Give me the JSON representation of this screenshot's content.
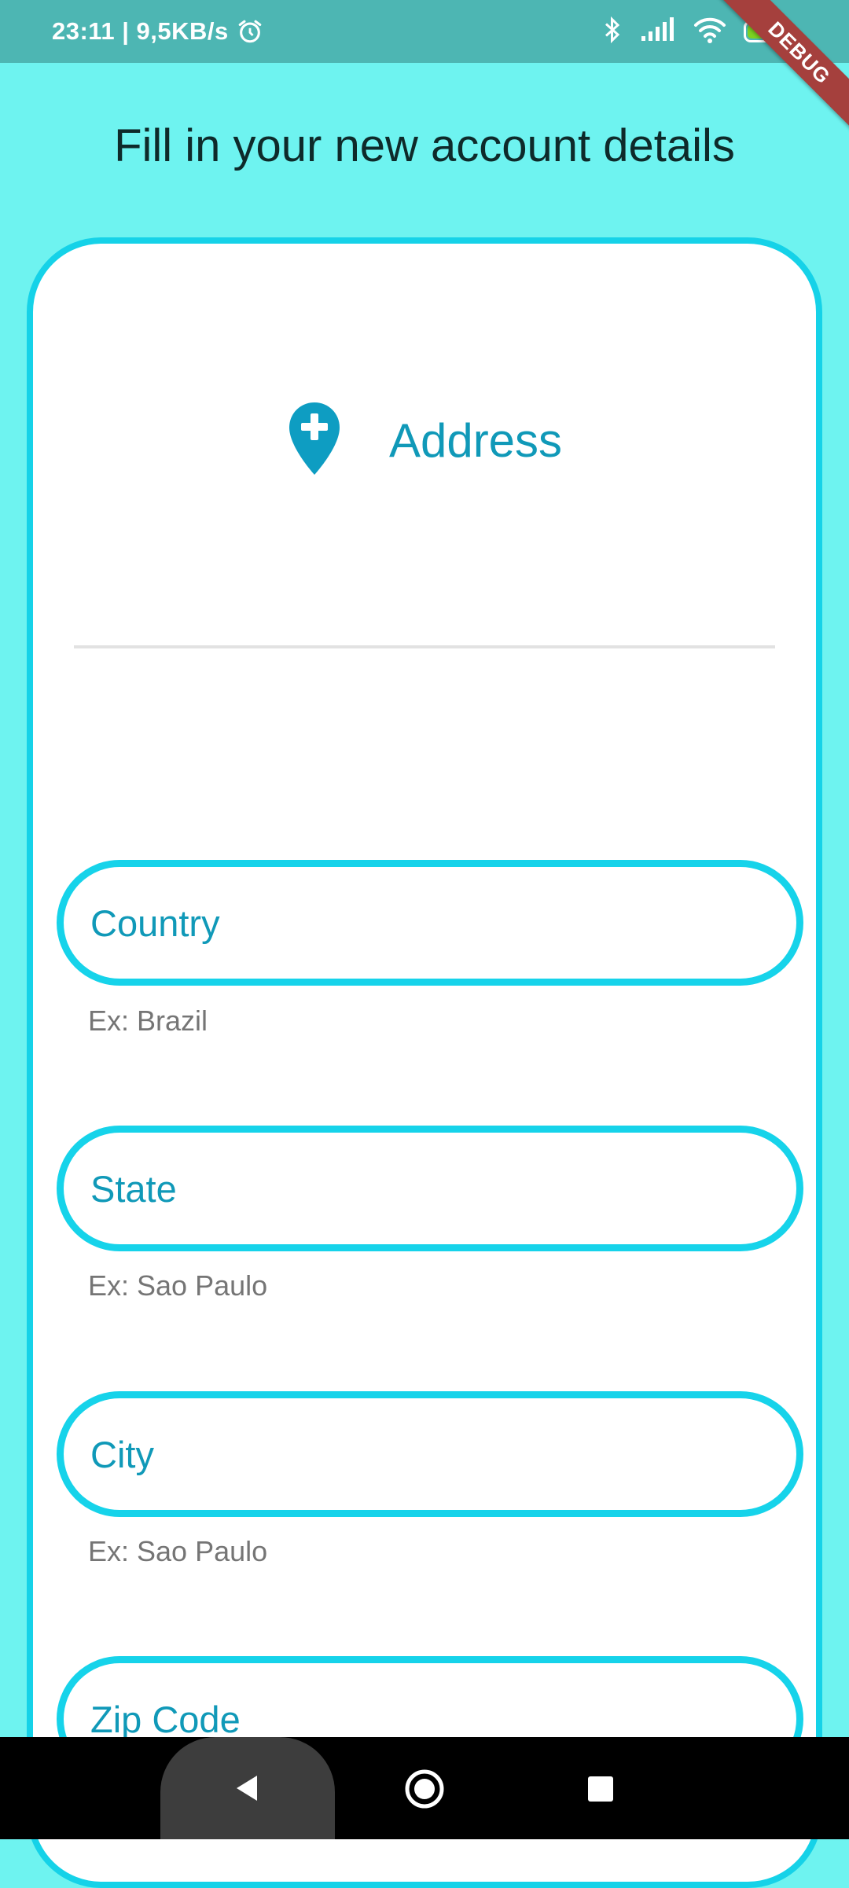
{
  "status_bar": {
    "time_speed": "23:11 | 9,5KB/s",
    "battery_level": "84",
    "icons": [
      "alarm-icon",
      "bluetooth-icon",
      "signal-icon",
      "wifi-icon",
      "battery-icon"
    ]
  },
  "debug_banner": "DEBUG",
  "page": {
    "title": "Fill in your new account details"
  },
  "card": {
    "section_icon": "add-location-icon",
    "section_title": "Address",
    "fields": [
      {
        "label": "Country",
        "hint": "Ex: Brazil"
      },
      {
        "label": "State",
        "hint": "Ex: Sao Paulo"
      },
      {
        "label": "City",
        "hint": "Ex: Sao Paulo"
      },
      {
        "label": "Zip Code",
        "hint": ""
      }
    ]
  },
  "nav_bar": {
    "icons": [
      "back-icon",
      "home-icon",
      "recents-icon"
    ]
  },
  "colors": {
    "background": "#6ef3f0",
    "status_bar": "#4db6b3",
    "accent": "#15d2e8",
    "label": "#1099b8",
    "hint": "#757575"
  }
}
